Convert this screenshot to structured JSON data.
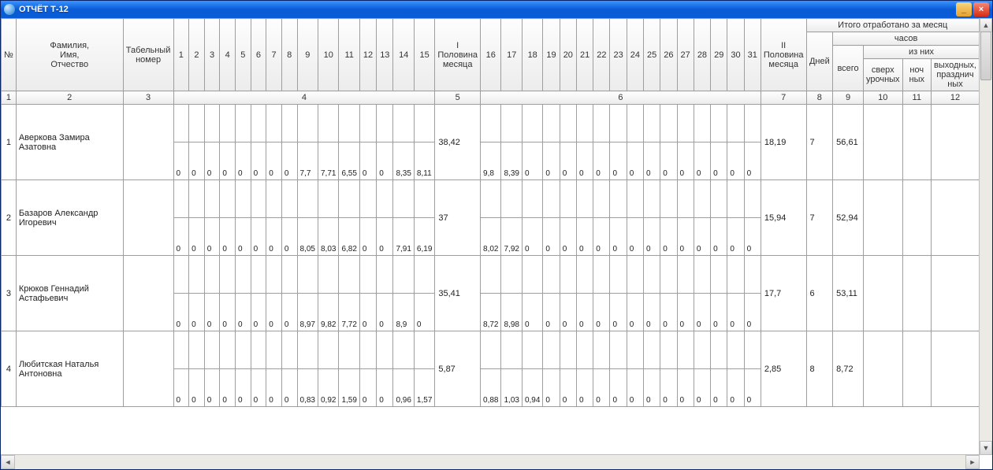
{
  "window": {
    "title": "ОТЧЁТ Т-12"
  },
  "header": {
    "num": "№",
    "fio": "Фамилия,\nИмя,\nОтчество",
    "tab": "Табельный\nномер",
    "half1": "I\nПоловина\nмесяца",
    "half2": "II\nПоловина\nмесяца",
    "month_total": "Итого отработано за месяц",
    "days_lbl": "Дней",
    "hours_lbl": "часов",
    "total_lbl": "всего",
    "of_them": "из них",
    "sub1": "сверх\nурочных",
    "sub2": "ноч\nных",
    "sub3": "выходных,\nпразднич\nных",
    "row2": {
      "c1": "1",
      "c2": "2",
      "c3": "3",
      "c4": "4",
      "c5": "5",
      "c6": "6",
      "c7": "7",
      "c8": "8",
      "c9": "9",
      "c10": "10",
      "c11": "11",
      "c12": "12"
    },
    "days1": [
      "1",
      "2",
      "3",
      "4",
      "5",
      "6",
      "7",
      "8",
      "9",
      "10",
      "11",
      "12",
      "13",
      "14",
      "15"
    ],
    "days2": [
      "16",
      "17",
      "18",
      "19",
      "20",
      "21",
      "22",
      "23",
      "24",
      "25",
      "26",
      "27",
      "28",
      "29",
      "30",
      "31"
    ]
  },
  "rows": [
    {
      "n": "1",
      "fio": "Аверкова Замира Азатовна",
      "tab": "",
      "d1": [
        "0",
        "0",
        "0",
        "0",
        "0",
        "0",
        "0",
        "0",
        "7,7",
        "7,71",
        "6,55",
        "0",
        "0",
        "8,35",
        "8,11"
      ],
      "half1": "38,42",
      "d2": [
        "9,8",
        "8,39",
        "0",
        "0",
        "0",
        "0",
        "0",
        "0",
        "0",
        "0",
        "0",
        "0",
        "0",
        "0",
        "0",
        "0"
      ],
      "half2": "18,19",
      "days": "7",
      "total": "56,61",
      "s1": "",
      "s2": "",
      "s3": ""
    },
    {
      "n": "2",
      "fio": "Базаров Александр Игоревич",
      "tab": "",
      "d1": [
        "0",
        "0",
        "0",
        "0",
        "0",
        "0",
        "0",
        "0",
        "8,05",
        "8,03",
        "6,82",
        "0",
        "0",
        "7,91",
        "6,19"
      ],
      "half1": "37",
      "d2": [
        "8,02",
        "7,92",
        "0",
        "0",
        "0",
        "0",
        "0",
        "0",
        "0",
        "0",
        "0",
        "0",
        "0",
        "0",
        "0",
        "0"
      ],
      "half2": "15,94",
      "days": "7",
      "total": "52,94",
      "s1": "",
      "s2": "",
      "s3": ""
    },
    {
      "n": "3",
      "fio": "Крюков Геннадий Астафьевич",
      "tab": "",
      "d1": [
        "0",
        "0",
        "0",
        "0",
        "0",
        "0",
        "0",
        "0",
        "8,97",
        "9,82",
        "7,72",
        "0",
        "0",
        "8,9",
        "0"
      ],
      "half1": "35,41",
      "d2": [
        "8,72",
        "8,98",
        "0",
        "0",
        "0",
        "0",
        "0",
        "0",
        "0",
        "0",
        "0",
        "0",
        "0",
        "0",
        "0",
        "0"
      ],
      "half2": "17,7",
      "days": "6",
      "total": "53,11",
      "s1": "",
      "s2": "",
      "s3": ""
    },
    {
      "n": "4",
      "fio": "Любитская Наталья Антоновна",
      "tab": "",
      "d1": [
        "0",
        "0",
        "0",
        "0",
        "0",
        "0",
        "0",
        "0",
        "0,83",
        "0,92",
        "1,59",
        "0",
        "0",
        "0,96",
        "1,57"
      ],
      "half1": "5,87",
      "d2": [
        "0,88",
        "1,03",
        "0,94",
        "0",
        "0",
        "0",
        "0",
        "0",
        "0",
        "0",
        "0",
        "0",
        "0",
        "0",
        "0",
        "0"
      ],
      "half2": "2,85",
      "days": "8",
      "total": "8,72",
      "s1": "",
      "s2": "",
      "s3": ""
    }
  ]
}
